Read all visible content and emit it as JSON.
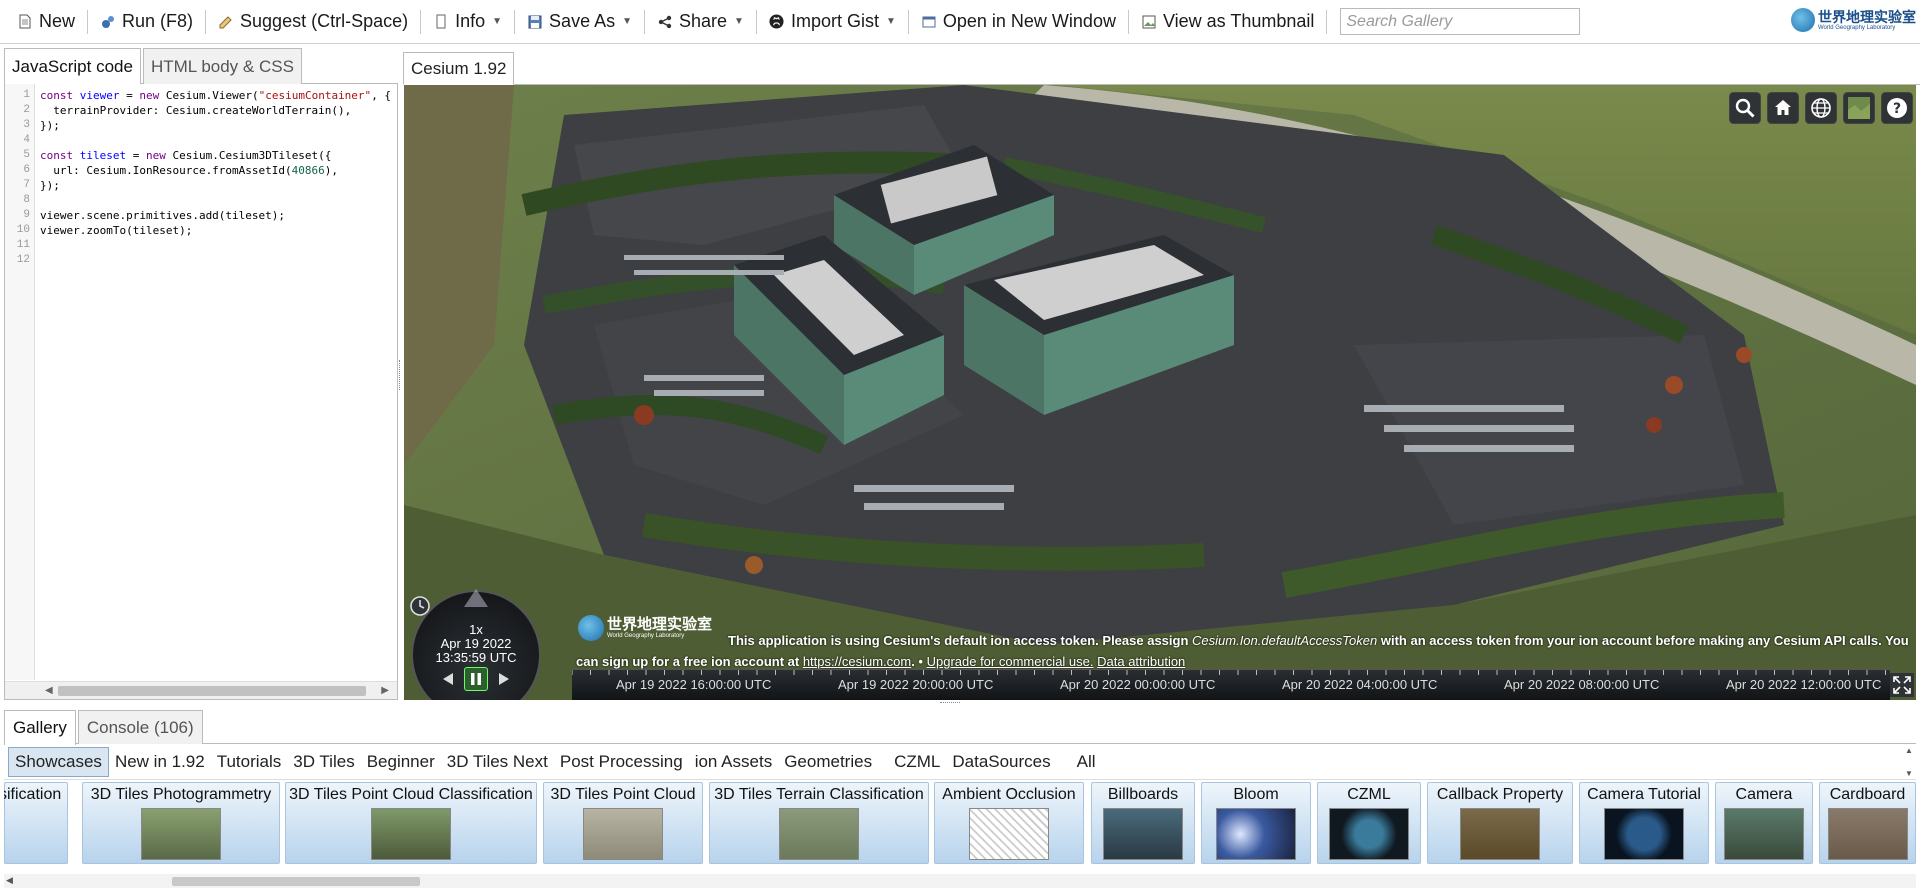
{
  "toolbar": {
    "buttons": [
      {
        "label": "New",
        "icon": "document-icon"
      },
      {
        "label": "Run (F8)",
        "icon": "run-icon"
      },
      {
        "label": "Suggest (Ctrl-Space)",
        "icon": "suggest-icon"
      },
      {
        "label": "Info",
        "icon": "info-icon"
      },
      {
        "label": "Save As",
        "icon": "save-icon"
      },
      {
        "label": "Share",
        "icon": "share-icon"
      },
      {
        "label": "Import Gist",
        "icon": "github-icon"
      },
      {
        "label": "Open in New Window",
        "icon": "window-icon"
      },
      {
        "label": "View as Thumbnail",
        "icon": "thumbnail-icon"
      }
    ],
    "search_placeholder": "Search Gallery",
    "brand_cn": "世界地理实验室",
    "brand_en": "World Geography Laboratory"
  },
  "editor": {
    "tabs": [
      "JavaScript code",
      "HTML body & CSS"
    ],
    "line_numbers": [
      "1",
      "2",
      "3",
      "4",
      "5",
      "6",
      "7",
      "8",
      "9",
      "10",
      "11",
      "12"
    ]
  },
  "viewer": {
    "tab_label": "Cesium 1.92",
    "animation": {
      "speed": "1x",
      "date": "Apr 19 2022",
      "time": "13:35:59 UTC"
    },
    "credit_logo_cn": "世界地理实验室",
    "credit_logo_en": "World Geography Laboratory",
    "credit_message_1": "This application is using Cesium's default ion access token. Please assign ",
    "credit_message_em": "Cesium.Ion.defaultAccessToken",
    "credit_message_2": " with an access token from your ion account before making any Cesium API calls. You can sign up for a free ion account at ",
    "credit_link": "https://cesium.com",
    "credit_message_3": ". • ",
    "credit_upgrade": "Upgrade for commercial use.",
    "credit_attribution": "Data attribution",
    "timeline_labels": [
      "Apr 19 2022 16:00:00 UTC",
      "Apr 19 2022 20:00:00 UTC",
      "Apr 20 2022 00:00:00 UTC",
      "Apr 20 2022 04:00:00 UTC",
      "Apr 20 2022 08:00:00 UTC",
      "Apr 20 2022 12:00:00 UTC"
    ]
  },
  "bottom": {
    "tabs": [
      "Gallery",
      "Console (106)"
    ],
    "filters": [
      "Showcases",
      "New in 1.92",
      "Tutorials",
      "3D Tiles",
      "Beginner",
      "3D Tiles Next",
      "Post Processing",
      "ion Assets",
      "Geometries",
      "CZML",
      "DataSources",
      "All"
    ],
    "cards": [
      {
        "title": "sification"
      },
      {
        "title": "3D Tiles Photogrammetry"
      },
      {
        "title": "3D Tiles Point Cloud Classification"
      },
      {
        "title": "3D Tiles Point Cloud"
      },
      {
        "title": "3D Tiles Terrain Classification"
      },
      {
        "title": "Ambient Occlusion"
      },
      {
        "title": "Billboards"
      },
      {
        "title": "Bloom"
      },
      {
        "title": "CZML"
      },
      {
        "title": "Callback Property"
      },
      {
        "title": "Camera Tutorial"
      },
      {
        "title": "Camera"
      },
      {
        "title": "Cardboard"
      }
    ]
  }
}
